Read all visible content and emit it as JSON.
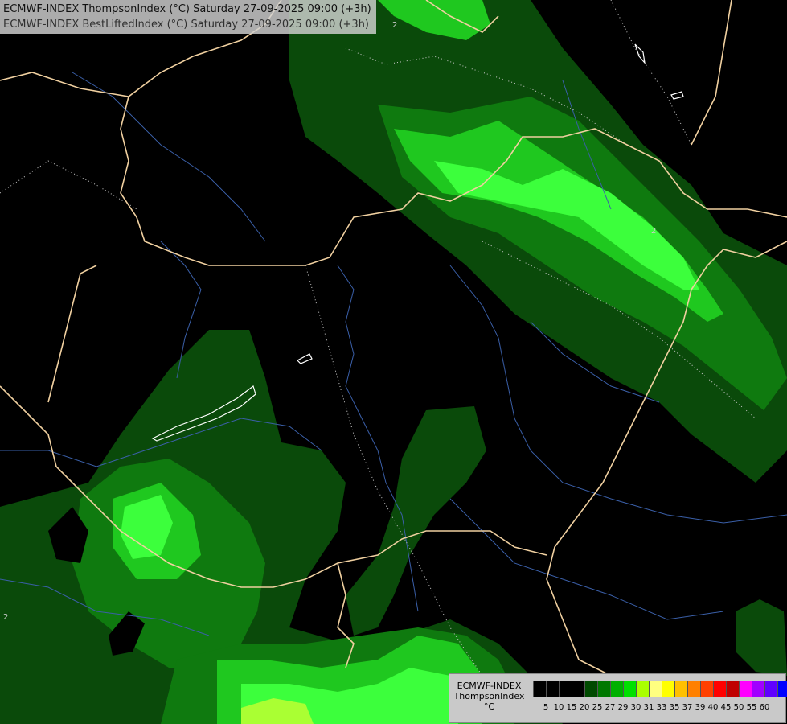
{
  "header": {
    "line1": "ECMWF-INDEX ThompsonIndex (°C) Saturday 27-09-2025 09:00 (+3h)",
    "line2": "ECMWF-INDEX BestLiftedIndex (°C) Saturday 27-09-2025 09:00 (+3h)"
  },
  "legend": {
    "model": "ECMWF-INDEX",
    "parameter": "ThompsonIndex",
    "unit": "°C",
    "ticks": [
      "5",
      "10",
      "15",
      "20",
      "25",
      "27",
      "29",
      "30",
      "31",
      "33",
      "35",
      "37",
      "39",
      "40",
      "45",
      "50",
      "55",
      "60"
    ],
    "colors": [
      "#000000",
      "#000000",
      "#000000",
      "#000000",
      "#004a00",
      "#007800",
      "#00b000",
      "#00e000",
      "#aaff00",
      "#ffff80",
      "#ffff00",
      "#ffc000",
      "#ff8000",
      "#ff4000",
      "#ff0000",
      "#c00000",
      "#ff00ff",
      "#a000ff",
      "#6000ff",
      "#0000ff"
    ]
  },
  "map_colors": {
    "background": "#000000",
    "dark_green": "#0a4a0a",
    "mid_green": "#0f7a0f",
    "bright_green": "#1fc81f",
    "lime": "#3cff3c",
    "border": "#f0d0a0",
    "river": "#3a5fa8",
    "isoline": "#cccccc"
  },
  "contour_labels": [
    "2",
    "2",
    "2"
  ]
}
